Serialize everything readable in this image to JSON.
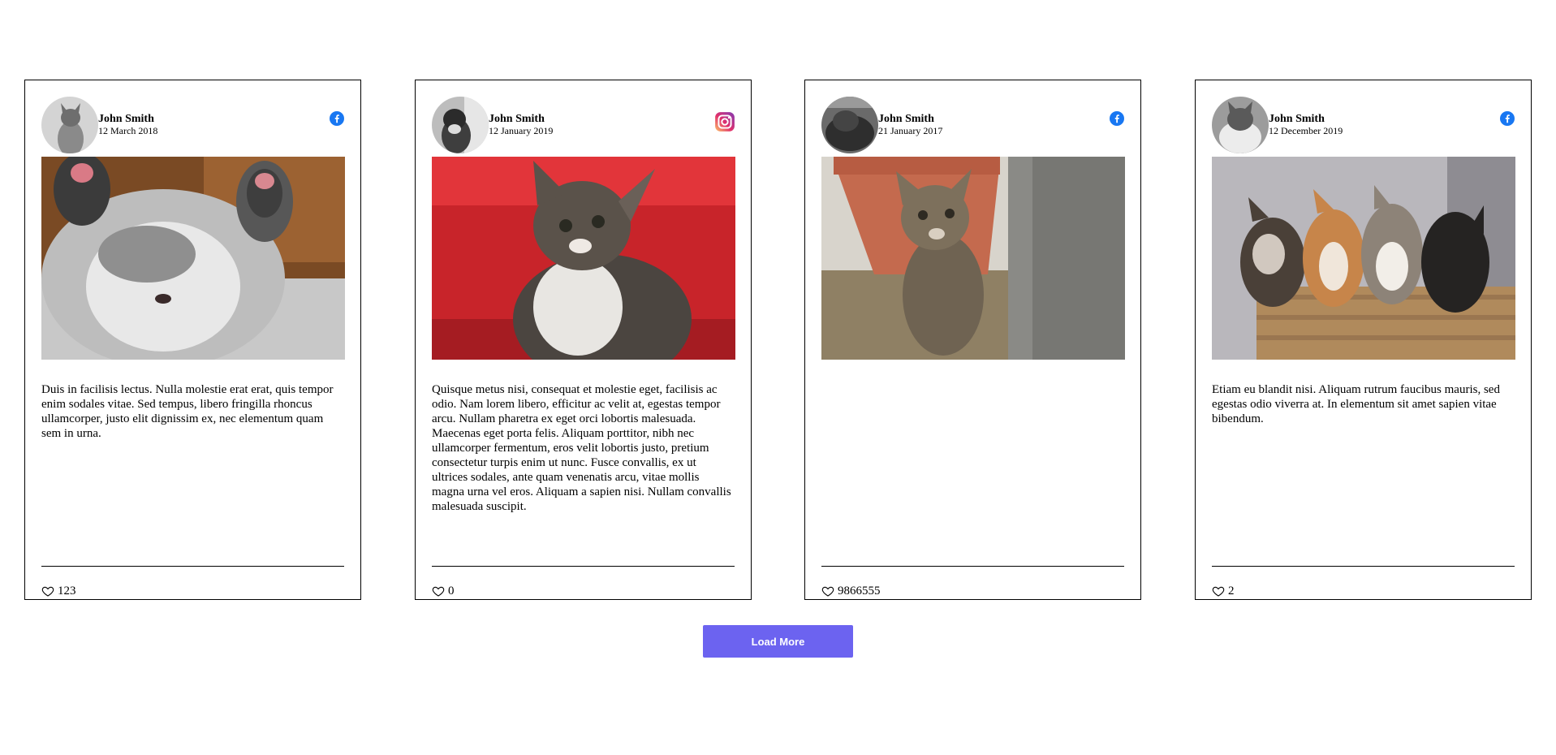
{
  "posts": [
    {
      "author": "John Smith",
      "date": "12 March 2018",
      "network": "facebook-icon",
      "text": "Duis in facilisis lectus. Nulla molestie erat erat, quis tempor enim sodales vitae. Sed tempus, libero fringilla rhoncus ullamcorper, justo elit dignissim ex, nec elementum quam sem in urna.",
      "likes": "123"
    },
    {
      "author": "John Smith",
      "date": "12 January 2019",
      "network": "instagram-icon",
      "text": "Quisque metus nisi, consequat et molestie eget, facilisis ac odio. Nam lorem libero, efficitur ac velit at, egestas tempor arcu. Nullam pharetra ex eget orci lobortis malesuada. Maecenas eget porta felis. Aliquam porttitor, nibh nec ullamcorper fermentum, eros velit lobortis justo, pretium consectetur turpis enim ut nunc. Fusce convallis, ex ut ultrices sodales, ante quam venenatis arcu, vitae mollis magna urna vel eros. Aliquam a sapien nisi. Nullam convallis malesuada suscipit.",
      "likes": "0"
    },
    {
      "author": "John Smith",
      "date": "21 January 2017",
      "network": "facebook-icon",
      "text": "",
      "likes": "9866555"
    },
    {
      "author": "John Smith",
      "date": "12 December 2019",
      "network": "facebook-icon",
      "text": "Etiam eu blandit nisi. Aliquam rutrum faucibus mauris, sed egestas odio viverra at. In elementum sit amet sapien vitae bibendum.",
      "likes": "2"
    }
  ],
  "load_more_label": "Load More",
  "colors": {
    "facebook": "#1877f2",
    "button": "#6c63f0"
  }
}
